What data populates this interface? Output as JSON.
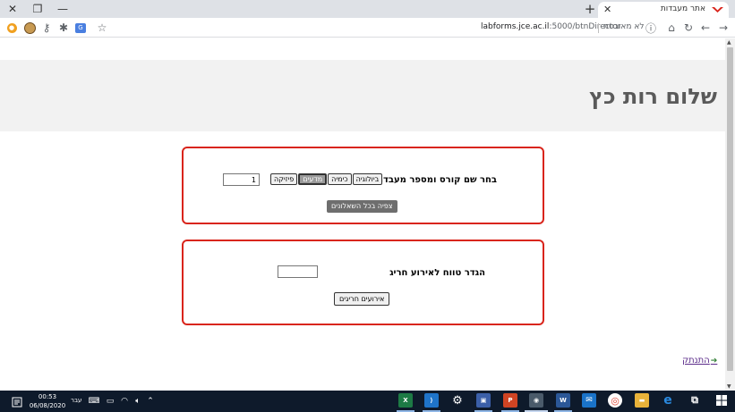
{
  "browser": {
    "tab_title": "אתר מעבדות",
    "new_tab": "+",
    "close_tab": "✕",
    "url_host": "labforms.jce.ac.il",
    "url_path": ":5000/btnDirector",
    "security_label": "לא מאובטח"
  },
  "page": {
    "greeting": "שלום רות כץ",
    "course_section": {
      "label": "בחר שם קורס ומספר מעבדה",
      "courses": [
        "ביולוגיה",
        "כימיה",
        "מדעים",
        "פיזיקה"
      ],
      "selected_course": "מדעים",
      "lab_number": "1",
      "view_all_button": "צפיה בכל השאלונים"
    },
    "exception_section": {
      "label": "הגדר טווח לאירוע חריג",
      "range_value": "",
      "events_button": "אירועים חריגים"
    },
    "logout_link": "התנתק"
  },
  "taskbar": {
    "time": "00:53",
    "date": "06/08/2020",
    "language": "עבר"
  },
  "colors": {
    "panel_border": "#d9251c",
    "jumbotron_bg": "#f2f2f2",
    "taskbar_bg": "#0e1a2b"
  }
}
